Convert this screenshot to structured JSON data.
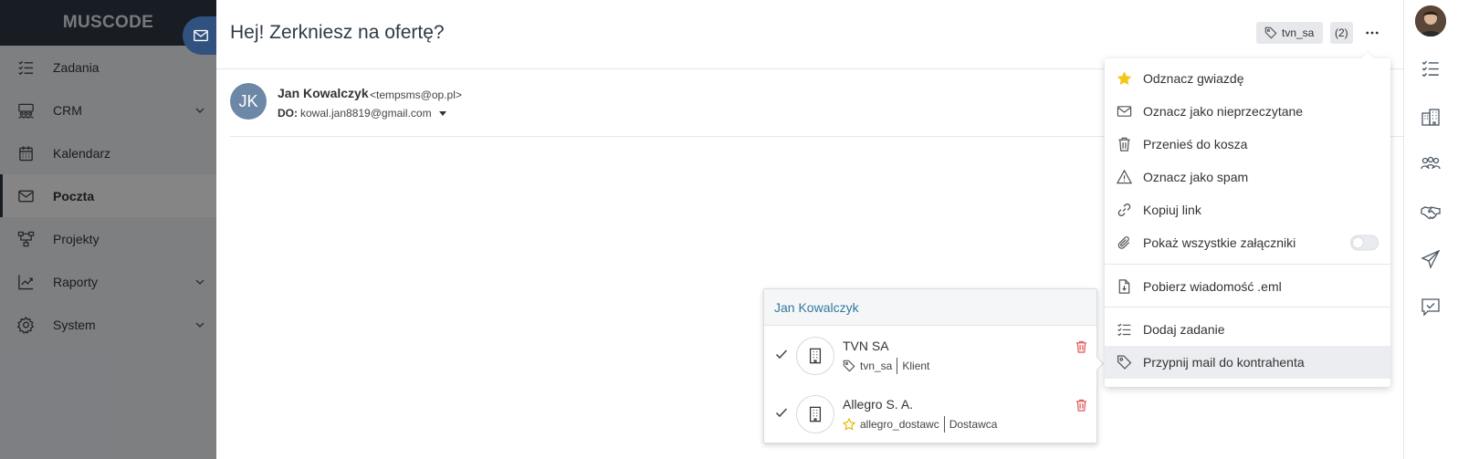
{
  "app": {
    "logo": "MUSCODE"
  },
  "sidebar": {
    "items": [
      {
        "label": "Zadania",
        "icon": "tasks-icon",
        "has_submenu": false
      },
      {
        "label": "CRM",
        "icon": "crm-icon",
        "has_submenu": true
      },
      {
        "label": "Kalendarz",
        "icon": "calendar-icon",
        "has_submenu": false
      },
      {
        "label": "Poczta",
        "icon": "mail-icon",
        "has_submenu": false,
        "active": true
      },
      {
        "label": "Projekty",
        "icon": "projects-icon",
        "has_submenu": false
      },
      {
        "label": "Raporty",
        "icon": "reports-icon",
        "has_submenu": true
      },
      {
        "label": "System",
        "icon": "settings-icon",
        "has_submenu": true
      }
    ]
  },
  "email": {
    "subject": "Hej! Zerkniesz na ofertę?",
    "tag": "tvn_sa",
    "tag_count": "(2)",
    "sender_initials": "JK",
    "sender_name": "Jan Kowalczyk",
    "sender_email": "<tempsms@op.pl>",
    "to_label": "DO:",
    "to_address": "kowal.jan8819@gmail.com"
  },
  "contractor_popup": {
    "title": "Jan Kowalczyk",
    "items": [
      {
        "name": "TVN SA",
        "tag": "tvn_sa",
        "type": "Klient",
        "tag_icon": "tag-icon"
      },
      {
        "name": "Allegro S. A.",
        "tag": "allegro_dostawc",
        "type": "Dostawca",
        "tag_icon": "star-outline-icon"
      }
    ]
  },
  "menu": {
    "items": [
      {
        "label": "Odznacz gwiazdę",
        "icon": "star-icon"
      },
      {
        "label": "Oznacz jako nieprzeczytane",
        "icon": "envelope-icon"
      },
      {
        "label": "Przenieś do kosza",
        "icon": "trash-icon"
      },
      {
        "label": "Oznacz jako spam",
        "icon": "warning-icon"
      },
      {
        "label": "Kopiuj link",
        "icon": "link-icon"
      },
      {
        "label": "Pokaż wszystkie załączniki",
        "icon": "paperclip-icon",
        "toggle": false
      },
      {
        "label": "Pobierz wiadomość .eml",
        "icon": "file-download-icon"
      },
      {
        "label": "Dodaj zadanie",
        "icon": "tasks-icon"
      },
      {
        "label": "Przypnij mail do kontrahenta",
        "icon": "tag-icon",
        "highlighted": true
      }
    ]
  },
  "colors": {
    "sidebar_dark": "#2c3542",
    "accent_blue": "#31527e",
    "link_blue": "#31799c",
    "star_yellow": "#f5c518",
    "danger_red": "#e05252"
  }
}
